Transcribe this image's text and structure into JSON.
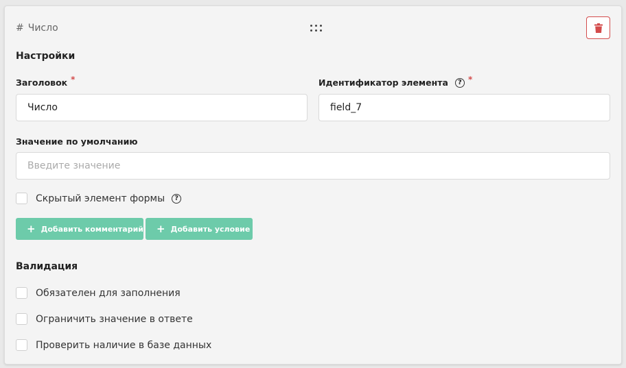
{
  "header": {
    "type_icon": "hash-icon",
    "type_label": "Число",
    "drag_icon": "drag-handle-icon",
    "delete_icon": "trash-icon"
  },
  "settings": {
    "title": "Настройки",
    "label_field": {
      "label": "Заголовок",
      "required_mark": "*",
      "value": "Число"
    },
    "id_field": {
      "label": "Идентификатор элемента",
      "help": "?",
      "required_mark": "*",
      "value": "field_7"
    },
    "default_field": {
      "label": "Значение по умолчанию",
      "placeholder": "Введите значение"
    },
    "hidden_checkbox": {
      "label": "Скрытый элемент формы",
      "help": "?",
      "checked": false
    },
    "buttons": {
      "add_comment": "Добавить комментарий",
      "add_condition": "Добавить условие",
      "plus": "+"
    }
  },
  "validation": {
    "title": "Валидация",
    "options": [
      {
        "label": "Обязателен для заполнения",
        "checked": false
      },
      {
        "label": "Ограничить значение в ответе",
        "checked": false
      },
      {
        "label": "Проверить наличие в базе данных",
        "checked": false
      }
    ]
  },
  "colors": {
    "accent_button": "#6dcbaa",
    "danger": "#d34b4b"
  }
}
